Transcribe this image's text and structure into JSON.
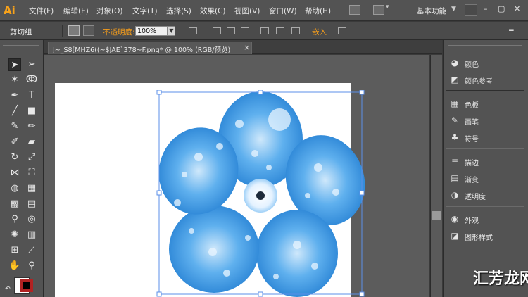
{
  "app": {
    "logo": "Ai",
    "workspace": "基本功能"
  },
  "menu": [
    "文件(F)",
    "编辑(E)",
    "对象(O)",
    "文字(T)",
    "选择(S)",
    "效果(C)",
    "视图(V)",
    "窗口(W)",
    "帮助(H)"
  ],
  "window_controls": {
    "minimize": "–",
    "maximize": "▢",
    "close": "✕"
  },
  "control_bar": {
    "clip_group": "剪切组",
    "opacity_label": "不透明度:",
    "opacity_value": "100%",
    "embed": "嵌入"
  },
  "document": {
    "tab_title": "J~_S8[MHZ6((~$JAE`378~F.png* @ 100% (RGB/预览)",
    "close": "×"
  },
  "panels": [
    {
      "label": "颜色",
      "icon": "color-icon"
    },
    {
      "label": "颜色参考",
      "icon": "color-guide-icon"
    },
    {
      "label": "色板",
      "icon": "swatches-icon"
    },
    {
      "label": "画笔",
      "icon": "brushes-icon"
    },
    {
      "label": "符号",
      "icon": "symbols-icon"
    },
    {
      "label": "描边",
      "icon": "stroke-icon"
    },
    {
      "label": "渐变",
      "icon": "gradient-icon"
    },
    {
      "label": "透明度",
      "icon": "transparency-icon"
    },
    {
      "label": "外观",
      "icon": "appearance-icon"
    },
    {
      "label": "图形样式",
      "icon": "graphic-styles-icon"
    }
  ],
  "colors": {
    "accent_orange": "#f39c1c",
    "flower_blue": "#3b9ae0",
    "stroke_red": "#b12222"
  },
  "watermark": "汇芳龙网"
}
